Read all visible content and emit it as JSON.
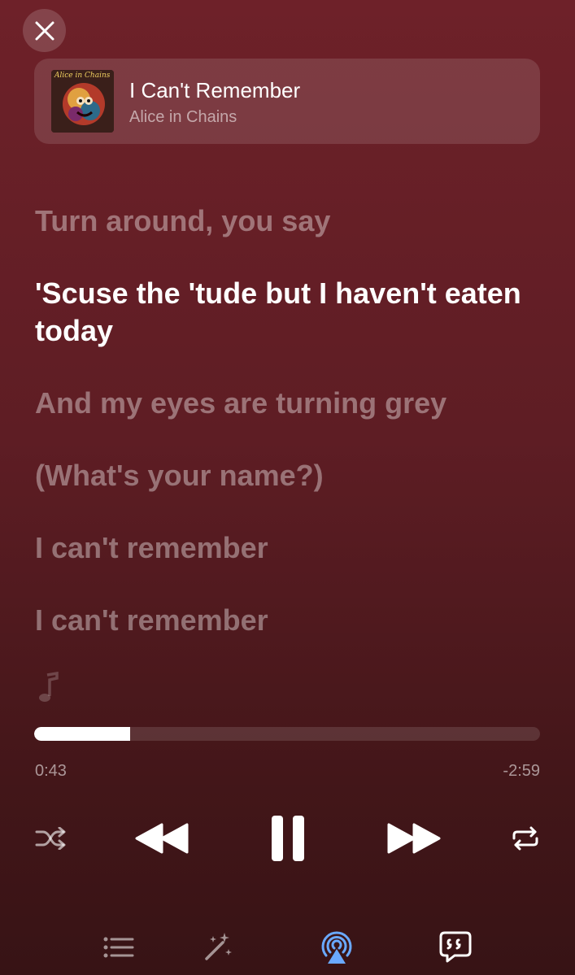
{
  "track": {
    "title": "I Can't Remember",
    "artist": "Alice in Chains",
    "artwork_text": "Alice in Chains"
  },
  "lyrics": [
    {
      "text": "Turn around, you say",
      "active": false
    },
    {
      "text": "'Scuse the 'tude but I haven't eaten today",
      "active": true
    },
    {
      "text": "And my eyes are turning grey",
      "active": false
    },
    {
      "text": "(What's your name?)",
      "active": false
    },
    {
      "text": "I can't remember",
      "active": false
    },
    {
      "text": "I can't remember",
      "active": false
    }
  ],
  "playback": {
    "elapsed": "0:43",
    "remaining": "-2:59",
    "progress": 0.19
  },
  "controls": {
    "shuffle": "shuffle-icon",
    "previous": "rewind-icon",
    "play_pause": "pause-icon",
    "next": "fast-forward-icon",
    "repeat": "repeat-icon"
  },
  "tabs": [
    {
      "icon": "queue-list-icon",
      "active": false
    },
    {
      "icon": "magic-wand-icon",
      "active": false
    },
    {
      "icon": "airplay-icon",
      "active": true
    },
    {
      "icon": "lyrics-quote-icon",
      "active": false
    }
  ],
  "colors": {
    "background_top": "#6e2129",
    "background_bottom": "#371315",
    "airplay_accent": "#6aa9ff"
  }
}
